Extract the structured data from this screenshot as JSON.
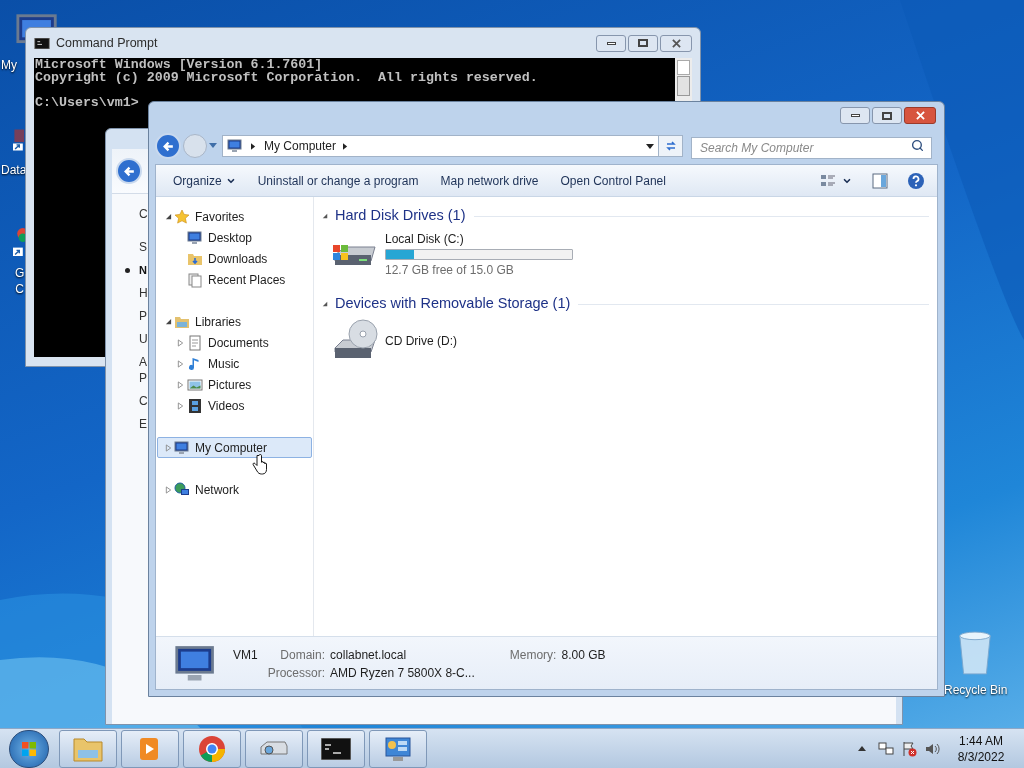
{
  "desktop": {
    "icons": [
      {
        "lines": [
          "My"
        ]
      },
      {
        "lines": [
          "Data"
        ]
      },
      {
        "lines": [
          "G",
          "C"
        ]
      },
      {
        "lines": [
          "Recycle Bin"
        ]
      }
    ]
  },
  "command_prompt": {
    "title": "Command Prompt",
    "lines": [
      "Microsoft Windows [Version 6.1.7601]",
      "Copyright (c) 2009 Microsoft Corporation.  All rights reserved."
    ],
    "prompt": "C:\\Users\\vm1>"
  },
  "background_window": {
    "items": [
      {
        "lines": [
          "C"
        ],
        "selected": false
      },
      {
        "lines": [
          "S"
        ],
        "selected": false
      },
      {
        "lines": [
          "N"
        ],
        "selected": true
      },
      {
        "lines": [
          "H"
        ],
        "selected": false
      },
      {
        "lines": [
          "P"
        ],
        "selected": false
      },
      {
        "lines": [
          "U"
        ],
        "selected": false
      },
      {
        "lines": [
          "A",
          "P"
        ],
        "selected": false
      },
      {
        "lines": [
          "C"
        ],
        "selected": false
      },
      {
        "lines": [
          "E"
        ],
        "selected": false
      }
    ]
  },
  "explorer": {
    "address": {
      "path": [
        "My Computer"
      ]
    },
    "search": {
      "placeholder": "Search My Computer"
    },
    "toolbar": [
      {
        "label": "Organize",
        "kind": "menu"
      },
      {
        "label": "Uninstall or change a program",
        "kind": "command"
      },
      {
        "label": "Map network drive",
        "kind": "command"
      },
      {
        "label": "Open Control Panel",
        "kind": "command"
      }
    ],
    "nav": [
      {
        "label": "Favorites",
        "expanded": true,
        "selected": false,
        "children": [
          {
            "label": "Desktop",
            "selected": false
          },
          {
            "label": "Downloads",
            "selected": false
          },
          {
            "label": "Recent Places",
            "selected": false
          }
        ]
      },
      {
        "label": "Libraries",
        "expanded": true,
        "selected": false,
        "children": [
          {
            "label": "Documents",
            "expanded": false,
            "selected": false
          },
          {
            "label": "Music",
            "expanded": false,
            "selected": false
          },
          {
            "label": "Pictures",
            "expanded": false,
            "selected": false
          },
          {
            "label": "Videos",
            "expanded": false,
            "selected": false
          }
        ]
      },
      {
        "label": "My Computer",
        "expanded": false,
        "selected": true
      },
      {
        "label": "Network",
        "expanded": false,
        "selected": false
      }
    ],
    "sections": [
      {
        "title": "Hard Disk Drives (1)",
        "expanded": true,
        "items": [
          {
            "kind": "disk",
            "name": "Local Disk (C:)",
            "level": 0.153,
            "detail": "12.7 GB free of 15.0 GB"
          }
        ]
      },
      {
        "title": "Devices with Removable Storage (1)",
        "expanded": true,
        "items": [
          {
            "kind": "cd",
            "name": "CD Drive (D:)"
          }
        ]
      }
    ],
    "details": {
      "name": "VM1",
      "fields": [
        {
          "label": "Domain:",
          "value": "collabnet.local"
        },
        {
          "label": "Memory:",
          "value": "8.00 GB"
        },
        {
          "label": "Processor:",
          "value": "AMD Ryzen 7 5800X 8-C..."
        }
      ]
    }
  },
  "taskbar": {
    "clock": {
      "time": "1:44 AM",
      "date": "8/3/2022"
    }
  }
}
